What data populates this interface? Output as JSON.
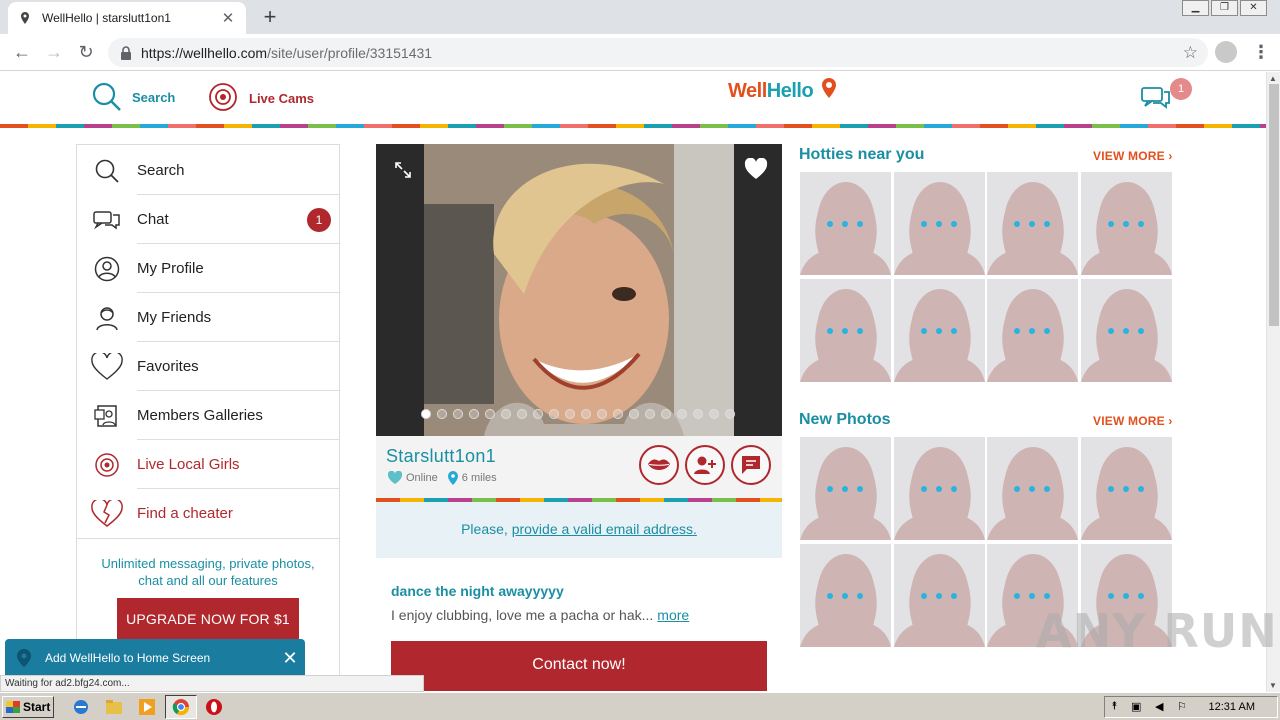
{
  "browser": {
    "tab_title": "WellHello | starslutt1on1",
    "url_host": "https://wellhello.com",
    "url_path": "/site/user/profile/33151431",
    "status_text": "Waiting for ad2.bfg24.com..."
  },
  "site": {
    "header": {
      "search_label": "Search",
      "livecams_label": "Live Cams",
      "logo_part1": "Well",
      "logo_part2": "Hello",
      "chat_count": "1"
    },
    "sidebar": {
      "items": [
        {
          "label": "Search",
          "icon": "search-icon"
        },
        {
          "label": "Chat",
          "icon": "chat-icon",
          "badge": "1"
        },
        {
          "label": "My Profile",
          "icon": "profile-icon"
        },
        {
          "label": "My Friends",
          "icon": "friends-icon"
        },
        {
          "label": "Favorites",
          "icon": "heart-outline-icon"
        },
        {
          "label": "Members Galleries",
          "icon": "gallery-icon"
        },
        {
          "label": "Live Local Girls",
          "icon": "webcam-icon"
        },
        {
          "label": "Find a cheater",
          "icon": "broken-heart-icon"
        }
      ],
      "promo_text": "Unlimited messaging, private photos, chat and all our features",
      "upgrade_label": "UPGRADE NOW FOR $1"
    },
    "profile": {
      "name": "Starslutt1on1",
      "status": "Online",
      "distance": "6 miles",
      "email_prompt_prefix": "Please, ",
      "email_prompt_link": "provide a valid email address.",
      "headline": "dance the night awayyyyy",
      "about": "I enjoy clubbing, love me a pacha or hak...",
      "more_label": "more",
      "contact_label": "Contact now!",
      "photo_count": 20,
      "active_photo": 1
    },
    "sections": {
      "hotties_title": "Hotties near you",
      "new_photos_title": "New Photos",
      "view_more_label": "VIEW MORE ›"
    },
    "a2hs": {
      "label": "Add WellHello to Home Screen"
    }
  },
  "watermark": "ANY RUN",
  "taskbar": {
    "start_label": "Start",
    "clock": "12:31 AM"
  },
  "colors": {
    "brand_teal": "#1aa0b0",
    "brand_red": "#b0282d",
    "brand_orange": "#e2501e"
  }
}
